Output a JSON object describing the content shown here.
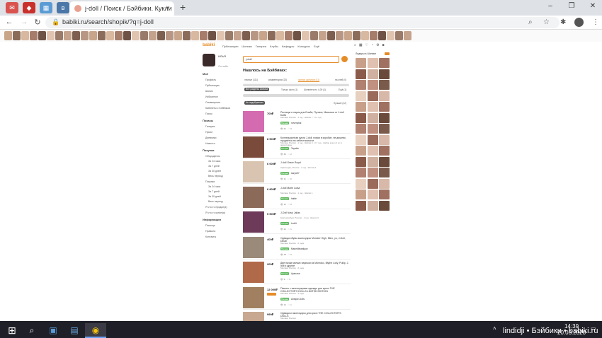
{
  "browser": {
    "tab_title": "j-doll / Поиск / Бэйбики. Кукли",
    "url": "babiki.ru/search/shopik/?q=j-doll",
    "close_symbol": "×",
    "newtab_symbol": "+"
  },
  "site": {
    "logo": "babiki",
    "nav": [
      "Публикации",
      "Шопики",
      "Галерея",
      "Клубы",
      "Кафедры",
      "Конкурсы",
      "Ещё"
    ],
    "user": {
      "name": "ИЛЬЯ",
      "status": "Онлайн"
    },
    "sidebar": {
      "sections": [
        {
          "title": "Моё",
          "items": [
            "Профиль",
            "Публикации",
            "Шопик",
            "Избранное",
            "Оповещения",
            "Кабинеты с Бэйбиков",
            "Поиск"
          ]
        },
        {
          "title": "Показы",
          "items": [
            "Галерея",
            "Приют",
            "Дневники",
            "Новости"
          ]
        },
        {
          "title": "Покупки",
          "items": [
            "Обсуждения",
            "За 24 часа",
            "За 7 дней",
            "За 30 дней",
            "Весь период",
            "Покупки",
            "За 24 часа",
            "За 7 дней",
            "За 30 дней",
            "Весь период",
            "Я что-то продал(а)",
            "Я что-то купил(а)"
          ]
        },
        {
          "title": "Информация",
          "items": [
            "Помощь",
            "Правила",
            "Контакты"
          ]
        }
      ]
    },
    "search": {
      "value": "j-doll",
      "title": "Нашлось на Бэйбиках:",
      "tabs": [
        {
          "label": "личные (111)",
          "active": false
        },
        {
          "label": "комментарии (22)",
          "active": false
        },
        {
          "label": "записи шопиков (11)",
          "active": true
        },
        {
          "label": "на клей (0)",
          "active": false
        }
      ],
      "filters": {
        "pill": "Все разделы Шопика",
        "mid": "Только фото (1)",
        "right": "Шоппинги по 4-00 (1)",
        "far": "Ещё (1)"
      },
      "sort": {
        "pill": "Не подобранные",
        "right": "Лучшие (12)"
      }
    },
    "listings": [
      {
        "price": "700₽",
        "title": "Ресницы и парик для Блайс, Пуллип, Мамочка от J-doll Баби",
        "meta": "Москва, Россия · 1 год · Шопик 7 · 0.1 год",
        "badge": "Продаю",
        "seller": "novenykai",
        "stats": "👁 31 · ♡ 0"
      },
      {
        "price": "8 500₽",
        "title": "Коллекционная кукла J-doll, новая в коробке, не дешево, продаётся по себестоимости",
        "meta": "Москва, Россия · 1 год · Шопик 4 · 0.7 год · Набор кукол 2 шт и аксессуары",
        "badge": "Продаю",
        "seller": "Tayabin",
        "stats": "👁 46 · ♡ 2"
      },
      {
        "price": "6 000₽",
        "title": "J-doll Grace Royal",
        "meta": "Краснодар, Россия · 1 год · Шопик 2",
        "badge": "Продаю",
        "seller": "saryaS7",
        "stats": "👁 11 · ♡ 0"
      },
      {
        "price": "6 800₽",
        "title": "J-doll Marie Luisa",
        "meta": "Москва, Россия · 1 год · Шопик 1",
        "badge": "Продаю",
        "seller": "hattie",
        "stats": "👁 12 · ♡ 0"
      },
      {
        "price": "5 500₽",
        "title": "J-Doll Navy Jallas",
        "meta": "Екатеринбург, Россия · 1 год · Шопик 3",
        "badge": "Продаю",
        "seller": "Ledlit",
        "stats": "👁 21 · ♡ 1"
      },
      {
        "price": "400₽",
        "title": "Одежда обувь аксессуары Monster High, Minx, yo, J-Doll, Dinah",
        "meta": "Москва, Россия · 2 года",
        "badge": "Продаю",
        "seller": "MarieMelantique",
        "stats": "👁 18 · ♡ 0"
      },
      {
        "price": "200₽",
        "title": "Две пачки мелких парички из Momoko, Blythe Lolly, Pullip, J-doll и другие",
        "meta": "Москва, Россия · 2 года",
        "badge": "Продаю",
        "seller": "Ayanana",
        "stats": "👁 9 · ♡ 0"
      },
      {
        "price": "12 000₽",
        "title": "Пакеты с аксессуарами одежды для кукол THE COLLECTOR'S DOLLS LIMITED EDITION",
        "meta": "Москва, Россия · 3 года",
        "badge": "Продаю",
        "seller": "Antique-Dolls",
        "stats": "👁 14 · ♡ 1"
      },
      {
        "price": "990₽",
        "title": "Одежда и аксессуары для кукол THE COLLECTOR'S DOLLS",
        "meta": "Москва, Россия",
        "badge": "Продаю",
        "seller": "",
        "stats": ""
      }
    ],
    "right_panel": {
      "title": "Лидеры в Шопике"
    }
  },
  "taskbar": {
    "clock_time": "14:39",
    "clock_date": "20.03.2020",
    "toast": "lindidji • Бэйбики • babiki.ru"
  },
  "colors": {
    "accent": "#e58c28",
    "badge_green": "#5cb85c",
    "taskbar": "#1f1f27"
  }
}
